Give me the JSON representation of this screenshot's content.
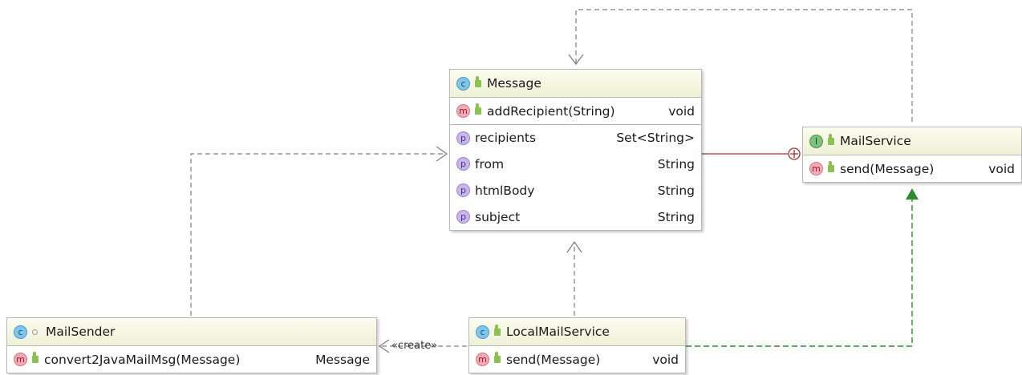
{
  "nodes": {
    "message": {
      "title": "Message",
      "methods": [
        {
          "name": "addRecipient(String)",
          "type": "void"
        }
      ],
      "fields": [
        {
          "name": "recipients",
          "type": "Set<String>"
        },
        {
          "name": "from",
          "type": "String"
        },
        {
          "name": "htmlBody",
          "type": "String"
        },
        {
          "name": "subject",
          "type": "String"
        }
      ]
    },
    "mail_service": {
      "title": "MailService",
      "methods": [
        {
          "name": "send(Message)",
          "type": "void"
        }
      ]
    },
    "mail_sender": {
      "title": "MailSender",
      "methods": [
        {
          "name": "convert2JavaMailMsg(Message)",
          "type": "Message"
        }
      ]
    },
    "local_mail_service": {
      "title": "LocalMailService",
      "methods": [
        {
          "name": "send(Message)",
          "type": "void"
        }
      ]
    }
  },
  "edges": {
    "create_label": "«create»"
  },
  "badges": {
    "class": "c",
    "interface": "I",
    "method": "m",
    "property": "p"
  },
  "colors": {
    "header_bg": "#eef1d6",
    "dependency": "#808080",
    "inner_class_link": "#a03030",
    "realization": "#2e8b2e"
  },
  "icons": [
    "class-icon",
    "interface-icon",
    "method-icon",
    "property-icon",
    "public-lock-icon",
    "package-private-icon"
  ]
}
